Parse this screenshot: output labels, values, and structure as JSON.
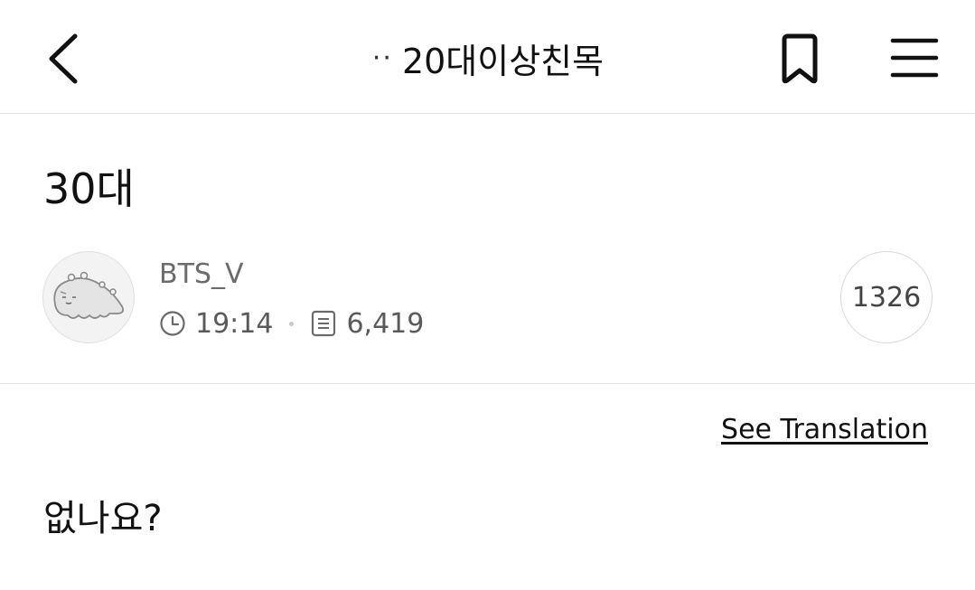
{
  "header": {
    "title_prefix": "··",
    "title": "20대이상친목",
    "back_icon": "chevron-left-icon",
    "bookmark_icon": "bookmark-icon",
    "menu_icon": "hamburger-menu-icon"
  },
  "post": {
    "title": "30대",
    "author": "BTS_V",
    "time": "19:14",
    "views": "6,419",
    "comment_count": "1326",
    "time_icon": "clock-icon",
    "views_icon": "document-icon",
    "avatar_icon": "cartoon-creature-avatar",
    "see_translation": "See Translation",
    "body": "없나요?"
  }
}
